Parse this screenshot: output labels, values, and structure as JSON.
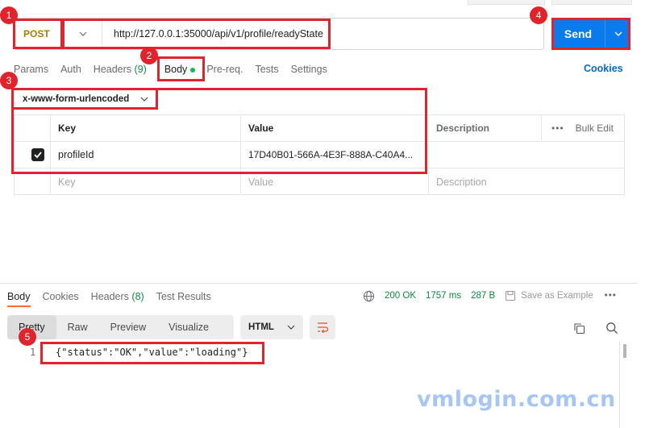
{
  "request": {
    "method": "POST",
    "url": "http://127.0.0.1:35000/api/v1/profile/readyState",
    "send_label": "Send",
    "tabs": [
      {
        "label": "Params"
      },
      {
        "label": "Auth"
      },
      {
        "label": "Headers",
        "count": "(9)"
      },
      {
        "label": "Body"
      },
      {
        "label": "Pre-req."
      },
      {
        "label": "Tests"
      },
      {
        "label": "Settings"
      }
    ],
    "cookies_label": "Cookies",
    "body_type": "x-www-form-urlencoded",
    "table": {
      "headers": {
        "key": "Key",
        "value": "Value",
        "description": "Description",
        "bulk_edit": "Bulk Edit"
      },
      "rows": [
        {
          "key": "profileId",
          "value": "17D40B01-566A-4E3F-888A-C40A4...",
          "checked": true
        }
      ],
      "placeholder": {
        "key": "Key",
        "value": "Value",
        "description": "Description"
      }
    }
  },
  "response": {
    "tabs": [
      {
        "label": "Body"
      },
      {
        "label": "Cookies"
      },
      {
        "label": "Headers",
        "count": "(8)"
      },
      {
        "label": "Test Results"
      }
    ],
    "status": "200 OK",
    "time": "1757 ms",
    "size": "287 B",
    "save_label": "Save as Example",
    "views": [
      "Pretty",
      "Raw",
      "Preview",
      "Visualize"
    ],
    "format": "HTML",
    "line_number": "1",
    "body_text": "{\"status\":\"OK\",\"value\":\"loading\"}"
  },
  "annotations": [
    "1",
    "2",
    "3",
    "4",
    "5"
  ],
  "watermark": "vmlogin.com.cn",
  "colors": {
    "accent": "#097bed",
    "highlight": "#e0242c",
    "method": "#ad7a03",
    "ok": "#0d8a3f"
  }
}
